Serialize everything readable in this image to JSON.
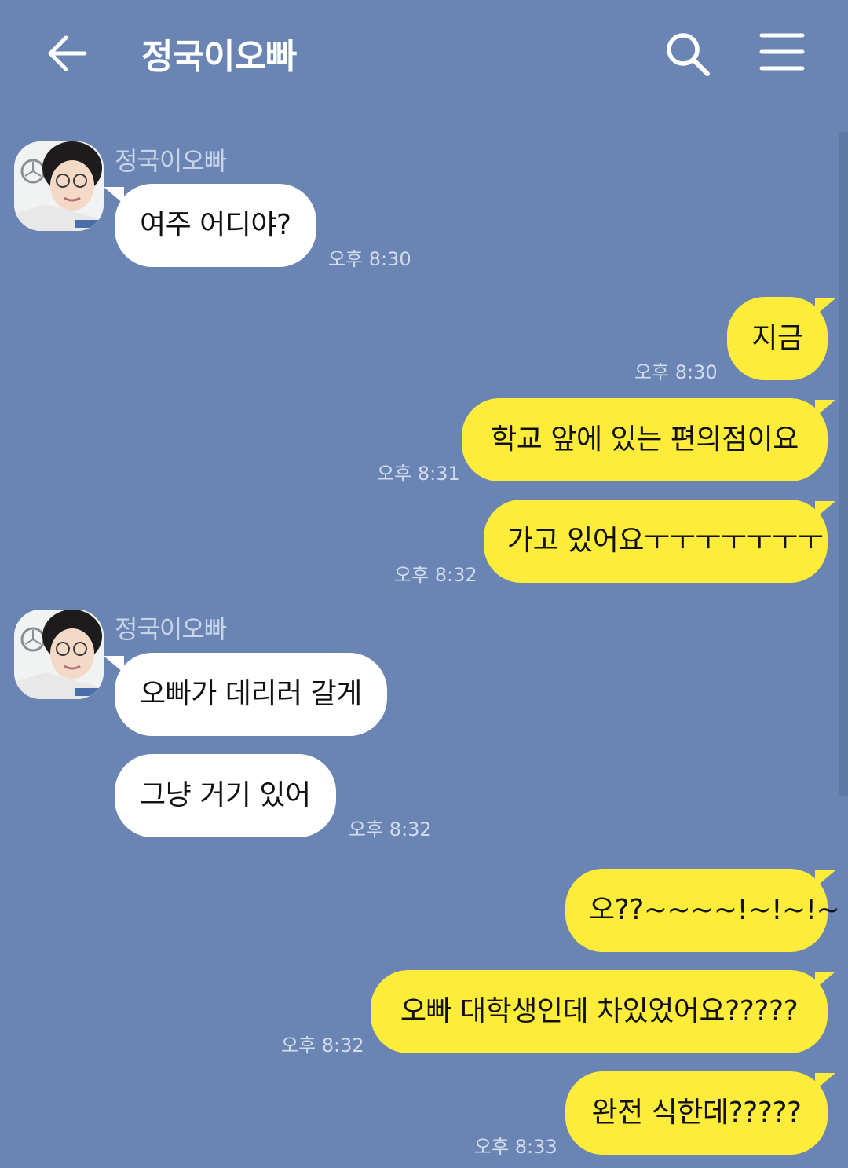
{
  "header": {
    "title": "정국이오빠",
    "back_icon": "arrow-left-icon",
    "search_icon": "search-icon",
    "menu_icon": "hamburger-menu-icon"
  },
  "colors": {
    "background": "#6a85b3",
    "incoming_bubble": "#ffffff",
    "outgoing_bubble": "#fdec3a",
    "meta_text": "#c8d4e8"
  },
  "groups": [
    {
      "sender": "정국이오빠",
      "messages": [
        {
          "text": "여주 어디야?",
          "time": "오후 8:30"
        }
      ]
    },
    {
      "sender": "me",
      "messages": [
        {
          "text": "지금",
          "time": "오후 8:30"
        },
        {
          "text": "학교 앞에 있는 편의점이요",
          "time": "오후 8:31"
        },
        {
          "text": "가고 있어요ㅜㅜㅜㅜㅜㅜㅜ",
          "time": "오후 8:32"
        }
      ]
    },
    {
      "sender": "정국이오빠",
      "messages": [
        {
          "text": "오빠가 데리러 갈게",
          "time": ""
        },
        {
          "text": "그냥 거기 있어",
          "time": "오후 8:32"
        }
      ]
    },
    {
      "sender": "me",
      "messages": [
        {
          "text": "오??~~~~!~!~!~",
          "time": ""
        },
        {
          "text": "오빠 대학생인데 차있었어요?????",
          "time": "오후 8:32"
        },
        {
          "text": "완전 식한데?????",
          "time": "오후 8:33"
        }
      ]
    }
  ]
}
